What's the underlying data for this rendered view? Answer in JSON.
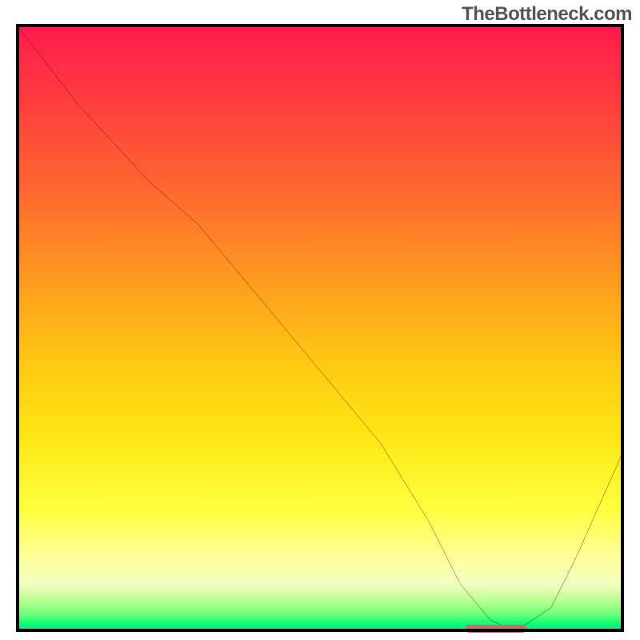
{
  "watermark": "TheBottleneck.com",
  "chart_data": {
    "type": "line",
    "title": "",
    "xlabel": "",
    "ylabel": "",
    "xlim": [
      0,
      100
    ],
    "ylim": [
      0,
      100
    ],
    "grid": false,
    "legend": false,
    "series": [
      {
        "name": "bottleneck-curve",
        "x": [
          0,
          10,
          22,
          30,
          40,
          50,
          60,
          68,
          73,
          78,
          82,
          88,
          92,
          96,
          100
        ],
        "values": [
          100,
          87,
          74,
          67,
          55,
          43,
          31,
          18,
          8,
          2,
          0,
          4,
          12,
          21,
          30
        ]
      }
    ],
    "marker": {
      "name": "optimal-range",
      "x_start": 74,
      "x_end": 84,
      "y": 0,
      "color": "#d06a6a"
    },
    "background": {
      "gradient_stops": [
        {
          "pos": 0,
          "color": "#ff1a4d"
        },
        {
          "pos": 0.28,
          "color": "#ff6a2f"
        },
        {
          "pos": 0.55,
          "color": "#ffc614"
        },
        {
          "pos": 0.8,
          "color": "#ffff40"
        },
        {
          "pos": 0.95,
          "color": "#b7ff8f"
        },
        {
          "pos": 1.0,
          "color": "#00db80"
        }
      ]
    }
  }
}
